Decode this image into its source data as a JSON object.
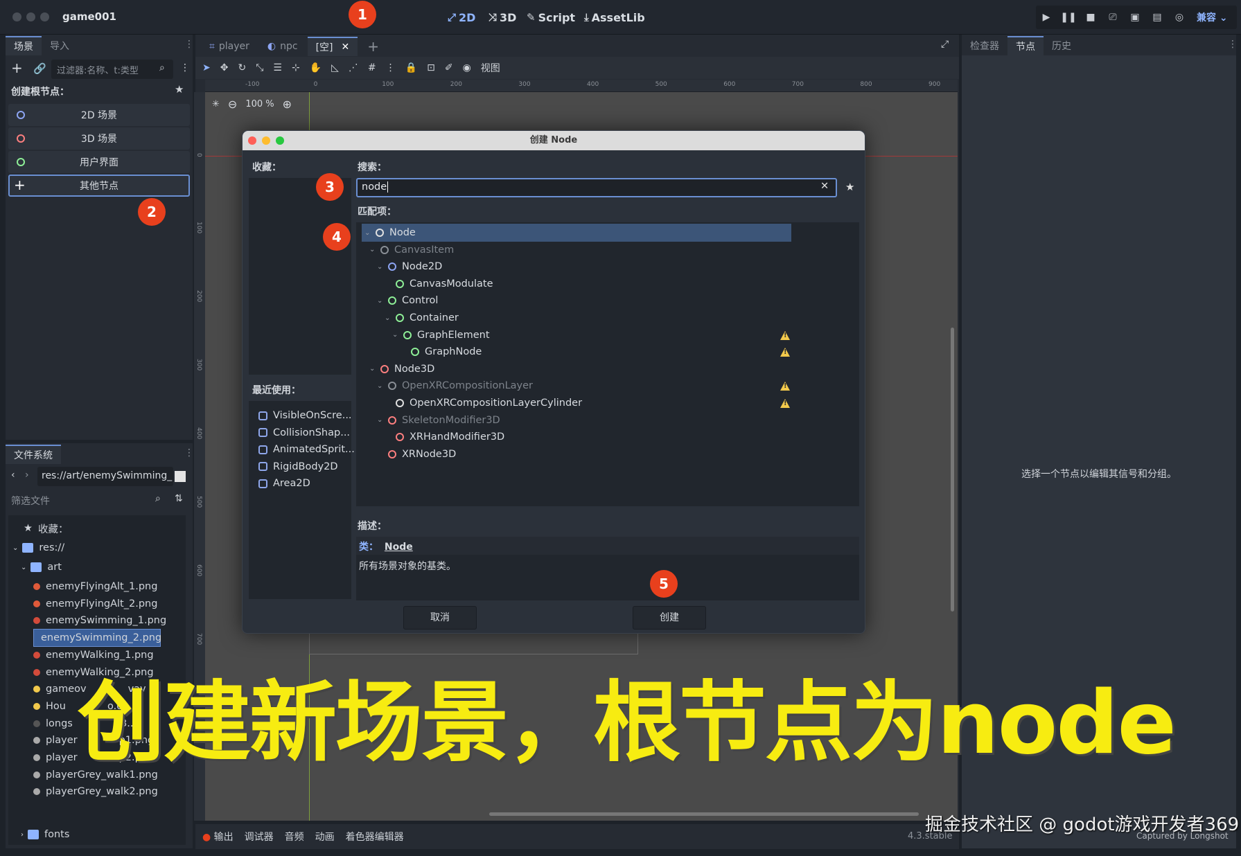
{
  "window": {
    "title": "game001"
  },
  "modes": [
    {
      "icon": "2d-icon",
      "label": "2D"
    },
    {
      "icon": "3d-icon",
      "label": "3D"
    },
    {
      "icon": "script-icon",
      "label": "Script"
    },
    {
      "icon": "assetlib-icon",
      "label": "AssetLib"
    }
  ],
  "renderer": "兼容",
  "scene_dock": {
    "tabs": [
      "场景",
      "导入"
    ],
    "filter_placeholder": "过滤器:名称、t:类型",
    "create_root_label": "创建根节点：",
    "root_buttons": [
      {
        "label": "2D 场景",
        "color": "#8da5f3"
      },
      {
        "label": "3D 场景",
        "color": "#fc7f7f"
      },
      {
        "label": "用户界面",
        "color": "#8eef97"
      },
      {
        "label": "其他节点",
        "color": "#ffffff"
      }
    ]
  },
  "filesystem": {
    "tab": "文件系统",
    "path": "res://art/enemySwimming_",
    "filter_placeholder": "筛选文件",
    "favorites_label": "收藏：",
    "root": "res://",
    "art_folder": "art",
    "files": [
      "enemyFlyingAlt_1.png",
      "enemyFlyingAlt_2.png",
      "enemySwimming_1.png",
      "enemySwimming_2.png",
      "enemyWalking_1.png",
      "enemyWalking_2.png",
      "gameov",
      "Hou",
      "longs",
      "player",
      "player",
      "playerGrey_walk1.png",
      "playerGrey_walk2.png"
    ],
    "file_suffixes": [
      "",
      "",
      "",
      "",
      "",
      "",
      "vav",
      "o.o..",
      "23..",
      "p1.png",
      "p2.png",
      "",
      ""
    ],
    "fonts_folder": "fonts"
  },
  "editor_tabs": [
    "player",
    "npc",
    "[空]"
  ],
  "toolbar": {
    "view_label": "视图"
  },
  "zoom": "100 %",
  "ruler_ticks": [
    "-100",
    "0",
    "100",
    "200",
    "300",
    "400",
    "500",
    "600",
    "700",
    "800",
    "900"
  ],
  "ruler_v_ticks": [
    "0",
    "100",
    "200",
    "300",
    "400",
    "500",
    "600",
    "700"
  ],
  "dialog": {
    "title": "创建 Node",
    "favorites_label": "收藏：",
    "search_label": "搜索：",
    "search_value": "node",
    "matches_label": "匹配项：",
    "recent_label": "最近使用：",
    "recent": [
      "VisibleOnScre...",
      "CollisionShap...",
      "AnimatedSprit...",
      "RigidBody2D",
      "Area2D"
    ],
    "tree": [
      {
        "label": "Node",
        "indent": 0,
        "color": "#e0e0e0",
        "chev": true,
        "selected": true,
        "warn": false,
        "dim": false
      },
      {
        "label": "CanvasItem",
        "indent": 1,
        "color": "#8a8f96",
        "chev": true,
        "selected": false,
        "warn": false,
        "dim": true
      },
      {
        "label": "Node2D",
        "indent": 2,
        "color": "#8da5f3",
        "chev": true,
        "selected": false,
        "warn": false,
        "dim": false
      },
      {
        "label": "CanvasModulate",
        "indent": 3,
        "color": "#8eef97",
        "chev": false,
        "selected": false,
        "warn": false,
        "dim": false
      },
      {
        "label": "Control",
        "indent": 2,
        "color": "#8eef97",
        "chev": true,
        "selected": false,
        "warn": false,
        "dim": false
      },
      {
        "label": "Container",
        "indent": 3,
        "color": "#8eef97",
        "chev": true,
        "selected": false,
        "warn": false,
        "dim": false
      },
      {
        "label": "GraphElement",
        "indent": 4,
        "color": "#8eef97",
        "chev": true,
        "selected": false,
        "warn": true,
        "dim": false
      },
      {
        "label": "GraphNode",
        "indent": 5,
        "color": "#8eef97",
        "chev": false,
        "selected": false,
        "warn": true,
        "dim": false
      },
      {
        "label": "Node3D",
        "indent": 1,
        "color": "#fc7f7f",
        "chev": true,
        "selected": false,
        "warn": false,
        "dim": false
      },
      {
        "label": "OpenXRCompositionLayer",
        "indent": 2,
        "color": "#8a8f96",
        "chev": true,
        "selected": false,
        "warn": true,
        "dim": true
      },
      {
        "label": "OpenXRCompositionLayerCylinder",
        "indent": 3,
        "color": "#e0e0e0",
        "chev": false,
        "selected": false,
        "warn": true,
        "dim": false
      },
      {
        "label": "SkeletonModifier3D",
        "indent": 2,
        "color": "#fc7f7f",
        "chev": true,
        "selected": false,
        "warn": false,
        "dim": true
      },
      {
        "label": "XRHandModifier3D",
        "indent": 3,
        "color": "#fc7f7f",
        "chev": false,
        "selected": false,
        "warn": false,
        "dim": false
      },
      {
        "label": "XRNode3D",
        "indent": 2,
        "color": "#fc7f7f",
        "chev": false,
        "selected": false,
        "warn": false,
        "dim": false
      }
    ],
    "description_label": "描述：",
    "class_label": "类：",
    "class_name": "Node",
    "description_text": "所有场景对象的基类。",
    "cancel_label": "取消",
    "create_label": "创建"
  },
  "inspector": {
    "tabs": [
      "检查器",
      "节点",
      "历史"
    ],
    "empty_text": "选择一个节点以编辑其信号和分组。"
  },
  "bottom_panel": {
    "tabs": [
      "输出",
      "调试器",
      "音频",
      "动画",
      "着色器编辑器"
    ],
    "version": "4.3.stable"
  },
  "markers": [
    "1",
    "2",
    "3",
    "4",
    "5"
  ],
  "overlay_caption": "创建新场景，根节点为node",
  "watermark": "掘金技术社区 @ godot游戏开发者369",
  "captured": "Captured by Longshot",
  "colors": {
    "accent": "#6a8fd2",
    "marker": "#e8401d",
    "caption": "#f7ec11"
  }
}
